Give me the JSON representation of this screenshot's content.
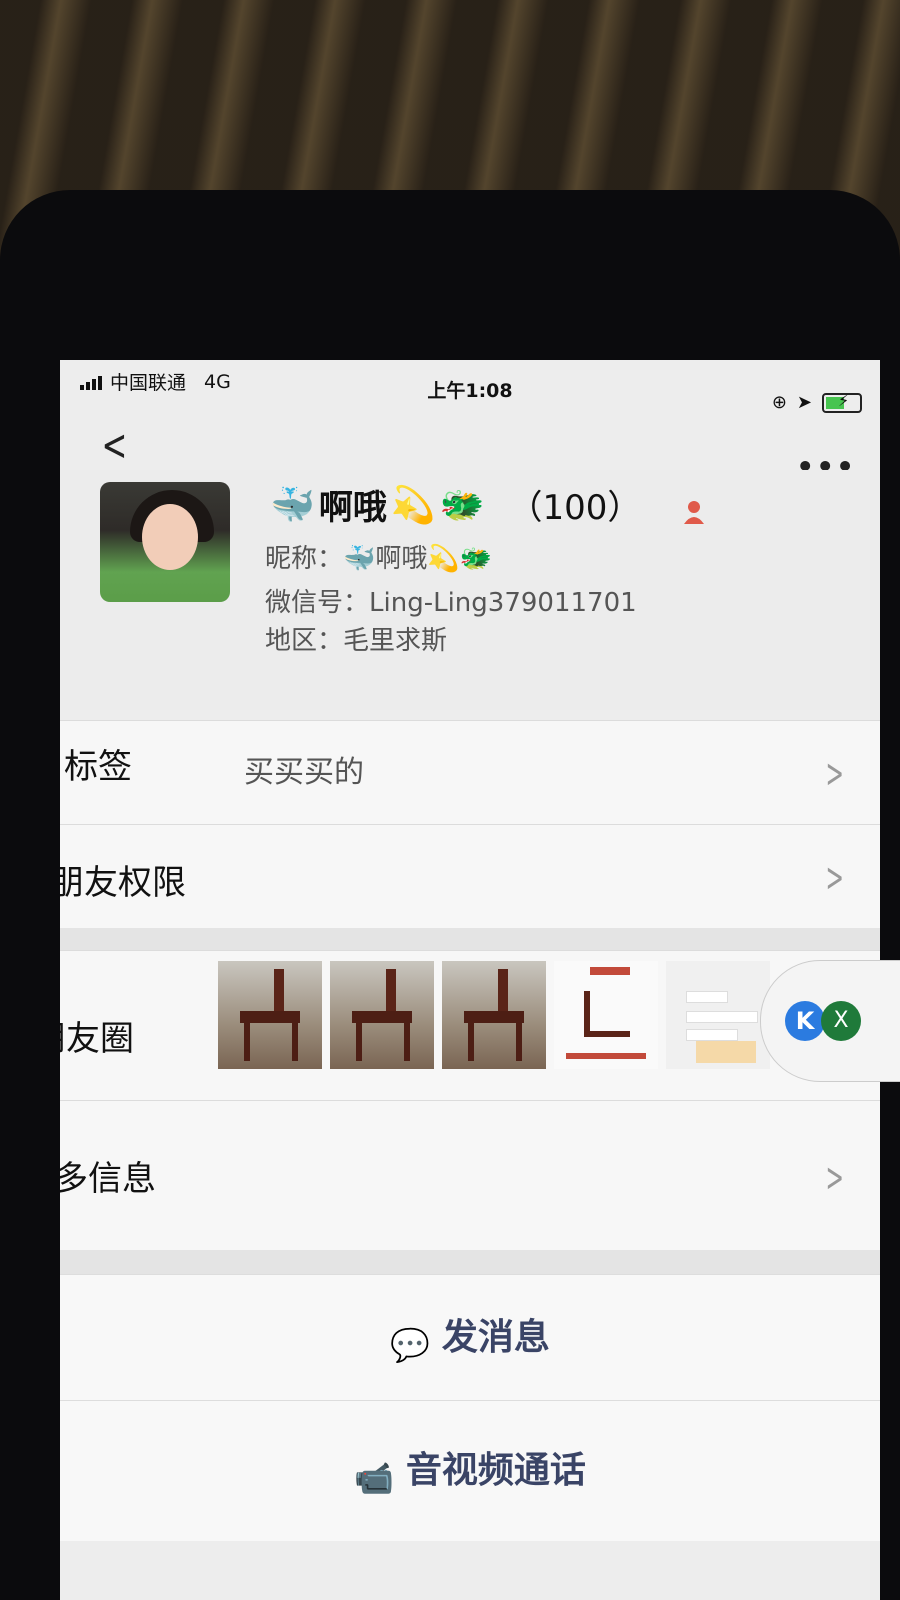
{
  "status_bar": {
    "carrier": "中国联通",
    "network": "4G",
    "time": "上午1:08"
  },
  "nav": {
    "back_icon": "chevron-left-icon",
    "more_icon": "more-dots-icon"
  },
  "profile": {
    "name": "啊哦",
    "name_suffix": "（100）",
    "nickname_label": "昵称：",
    "nickname": "啊哦",
    "wechat_id_label": "微信号：",
    "wechat_id": "Ling-Ling379011701",
    "region_label": "地区：",
    "region": "毛里求斯",
    "emoji_whale": "🐳",
    "emoji_dizzy": "💫",
    "emoji_dragon": "🐲"
  },
  "rows": {
    "tags_label": "标签",
    "tags_value": "买买买的",
    "permissions_label": "朋友权限",
    "moments_label": "朋友圈",
    "more_info_label": "更多信息"
  },
  "floating_widget": {
    "k_label": "K",
    "x_label": "X"
  },
  "actions": {
    "message_label": "发消息",
    "call_label": "音视频通话"
  }
}
